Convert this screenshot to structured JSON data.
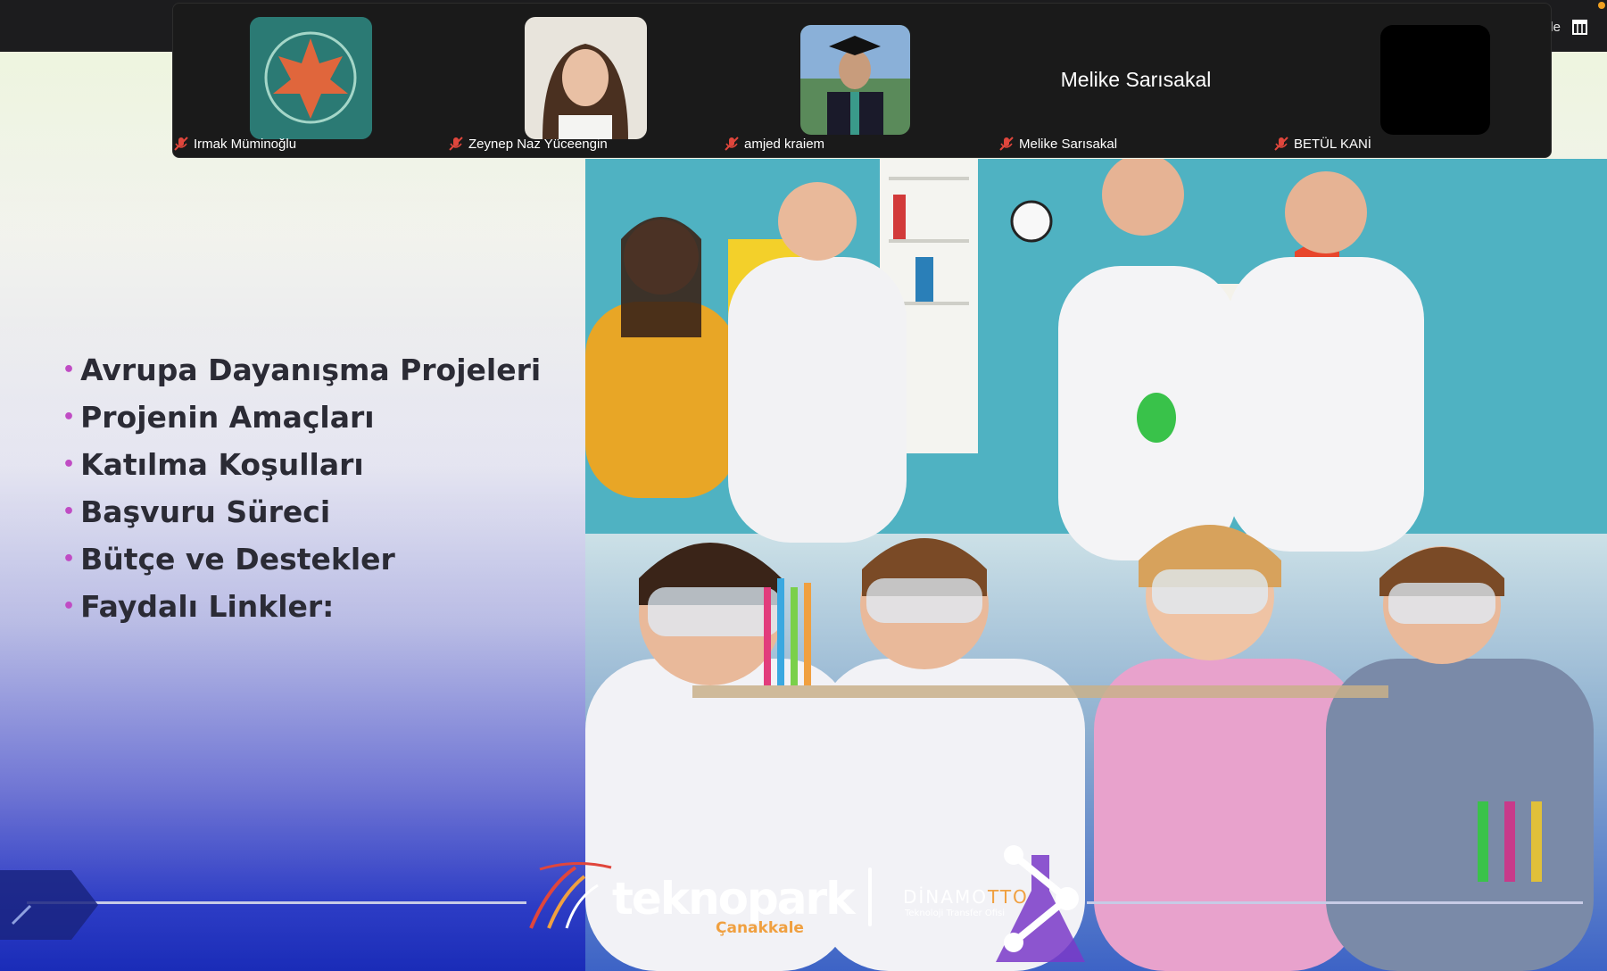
{
  "toolbar": {
    "view_label": "üle",
    "view_icon": "grid-view-icon"
  },
  "participants": [
    {
      "name": "Irmak Müminoğlu",
      "muted": true,
      "thumb": "maple-leaf-avatar"
    },
    {
      "name": "Zeynep Naz Yüceengin",
      "muted": true,
      "thumb": "photo"
    },
    {
      "name": "amjed kraiem",
      "muted": true,
      "thumb": "photo"
    },
    {
      "name": "Melike Sarısakal",
      "muted": true,
      "display_name": "Melike Sarısakal"
    },
    {
      "name": "BETÜL KANİ",
      "muted": true,
      "thumb": "black"
    }
  ],
  "slide": {
    "bullets": [
      "Avrupa Dayanışma Projeleri",
      "Projenin Amaçları",
      "Katılma Koşulları",
      "Başvuru Süreci",
      "Bütçe ve Destekler",
      "Faydalı Linkler:"
    ],
    "logo1_name": "teknopark",
    "logo1_city": "Çanakkale",
    "logo2_name_main": "DİNAMO",
    "logo2_name_accent": "TTO",
    "logo2_sub": "Teknoloji Transfer Ofisi"
  },
  "colors": {
    "bullet_dot": "#c04cc4",
    "accent_orange": "#f0a040",
    "mic_muted": "#e0463c"
  }
}
